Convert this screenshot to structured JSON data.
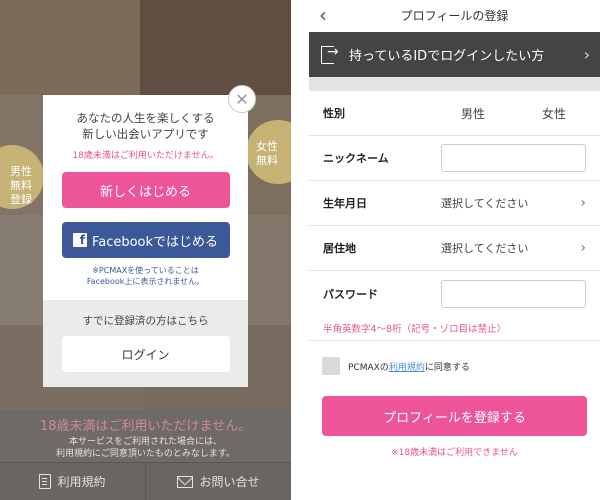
{
  "left_screen": {
    "bubble_left": "男性\n無料\n登録",
    "bubble_right": "女性\n無料",
    "modal": {
      "headline_1": "あなたの人生を楽しくする",
      "headline_2": "新しい出会いアプリです",
      "age_notice": "18歳未満はご利用いただけません。",
      "start_button": "新しくはじめる",
      "facebook_button": "Facebookではじめる",
      "facebook_note_1": "※PCMAXを使っていることは",
      "facebook_note_2": "Facebook上に表示されません。",
      "already_registered": "すでに登録済の方はこちら",
      "login_button": "ログイン",
      "close_glyph": "✕"
    },
    "bottom_notice": {
      "title": "18歳未満はご利用いただけません。",
      "body_1": "本サービスをご利用された場合には、",
      "body_2": "利用規約にご同意頂いたものとみなします。"
    },
    "footer": {
      "terms": "利用規約",
      "contact": "お問い合せ"
    }
  },
  "right_screen": {
    "title": "プロフィールの登録",
    "back_glyph": "‹",
    "id_login_bar": "持っているIDでログインしたい方",
    "chevron_glyph": "›",
    "form": {
      "gender_label": "性別",
      "gender_male": "男性",
      "gender_female": "女性",
      "nickname_label": "ニックネーム",
      "birthdate_label": "生年月日",
      "birthdate_value": "選択してください",
      "residence_label": "居住地",
      "residence_value": "選択してください",
      "password_label": "パスワード",
      "password_note": "半角英数字4〜8桁（記号・ゾロ目は禁止）"
    },
    "agree_prefix": "PCMAXの",
    "agree_link": "利用規約",
    "agree_suffix": "に同意する",
    "register_button": "プロフィールを登録する",
    "age_notice": "※18歳未満はご利用できません"
  },
  "colors": {
    "accent_pink": "#ee5599",
    "facebook_blue": "#3b5998",
    "link_blue": "#4a90d9",
    "dark_bar": "#444444"
  }
}
